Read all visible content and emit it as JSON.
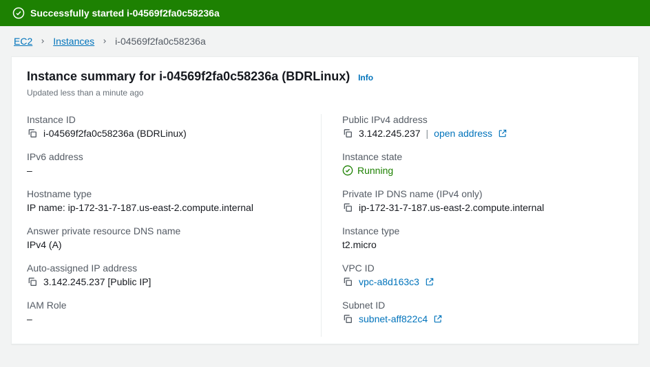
{
  "banner": {
    "message": "Successfully started i-04569f2fa0c58236a"
  },
  "breadcrumb": {
    "ec2": "EC2",
    "instances": "Instances",
    "current": "i-04569f2fa0c58236a"
  },
  "header": {
    "title": "Instance summary for i-04569f2fa0c58236a (BDRLinux)",
    "info": "Info",
    "updated": "Updated less than a minute ago"
  },
  "left": {
    "instance_id_label": "Instance ID",
    "instance_id_value": "i-04569f2fa0c58236a (BDRLinux)",
    "ipv6_label": "IPv6 address",
    "ipv6_value": "–",
    "hostname_type_label": "Hostname type",
    "hostname_type_value": "IP name: ip-172-31-7-187.us-east-2.compute.internal",
    "answer_dns_label": "Answer private resource DNS name",
    "answer_dns_value": "IPv4 (A)",
    "auto_ip_label": "Auto-assigned IP address",
    "auto_ip_value": "3.142.245.237 [Public IP]",
    "iam_label": "IAM Role",
    "iam_value": "–"
  },
  "right": {
    "public_ipv4_label": "Public IPv4 address",
    "public_ipv4_value": "3.142.245.237",
    "open_address": "open address",
    "state_label": "Instance state",
    "state_value": "Running",
    "private_dns_label": "Private IP DNS name (IPv4 only)",
    "private_dns_value": "ip-172-31-7-187.us-east-2.compute.internal",
    "instance_type_label": "Instance type",
    "instance_type_value": "t2.micro",
    "vpc_label": "VPC ID",
    "vpc_value": "vpc-a8d163c3",
    "subnet_label": "Subnet ID",
    "subnet_value": "subnet-aff822c4"
  }
}
